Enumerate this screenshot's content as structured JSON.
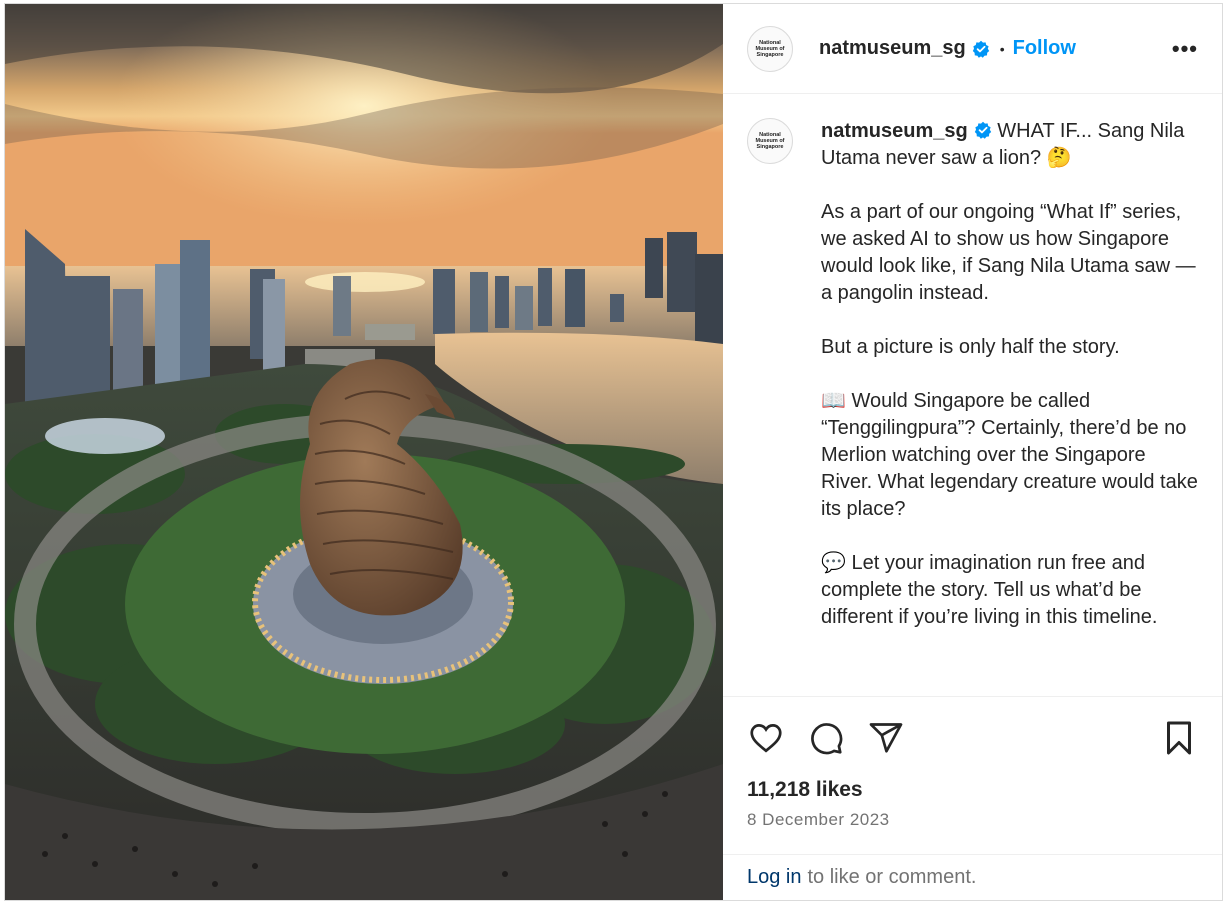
{
  "account": {
    "username": "natmuseum_sg",
    "avatar_text": "National Museum of Singapore",
    "verified_icon": "verified-badge-icon",
    "follow_label": "Follow",
    "separator": "•",
    "more_label": "•••"
  },
  "post": {
    "image_alt": "AI image of a giant pangolin sculpture in a roundabout at sunset over Singapore skyline",
    "caption": {
      "username": "natmuseum_sg",
      "text": " WHAT IF... Sang Nila Utama never saw a lion? 🤔\n\nAs a part of our ongoing “What If” series, we asked AI to show us how Singapore would look like, if Sang Nila Utama saw — a pangolin instead.\n\nBut a picture is only half the story.\n\n📖 Would Singapore be called “Tenggilingpura”? Certainly, there’d be no Merlion watching over the Singapore River. What legendary creature would take its place?\n\n💬 Let your imagination run free and complete the story. Tell us what’d be different if you’re living in this timeline."
    },
    "likes": "11,218 likes",
    "date": "8 December 2023"
  },
  "actions": {
    "like_icon": "heart-icon",
    "comment_icon": "comment-icon",
    "share_icon": "send-icon",
    "save_icon": "bookmark-icon"
  },
  "footer": {
    "login_link": "Log in",
    "login_suffix": "to like or comment."
  },
  "colors": {
    "link_blue": "#0095f6",
    "verified_blue": "#0095f6",
    "login_blue": "#00376b",
    "secondary_text": "#737373"
  }
}
